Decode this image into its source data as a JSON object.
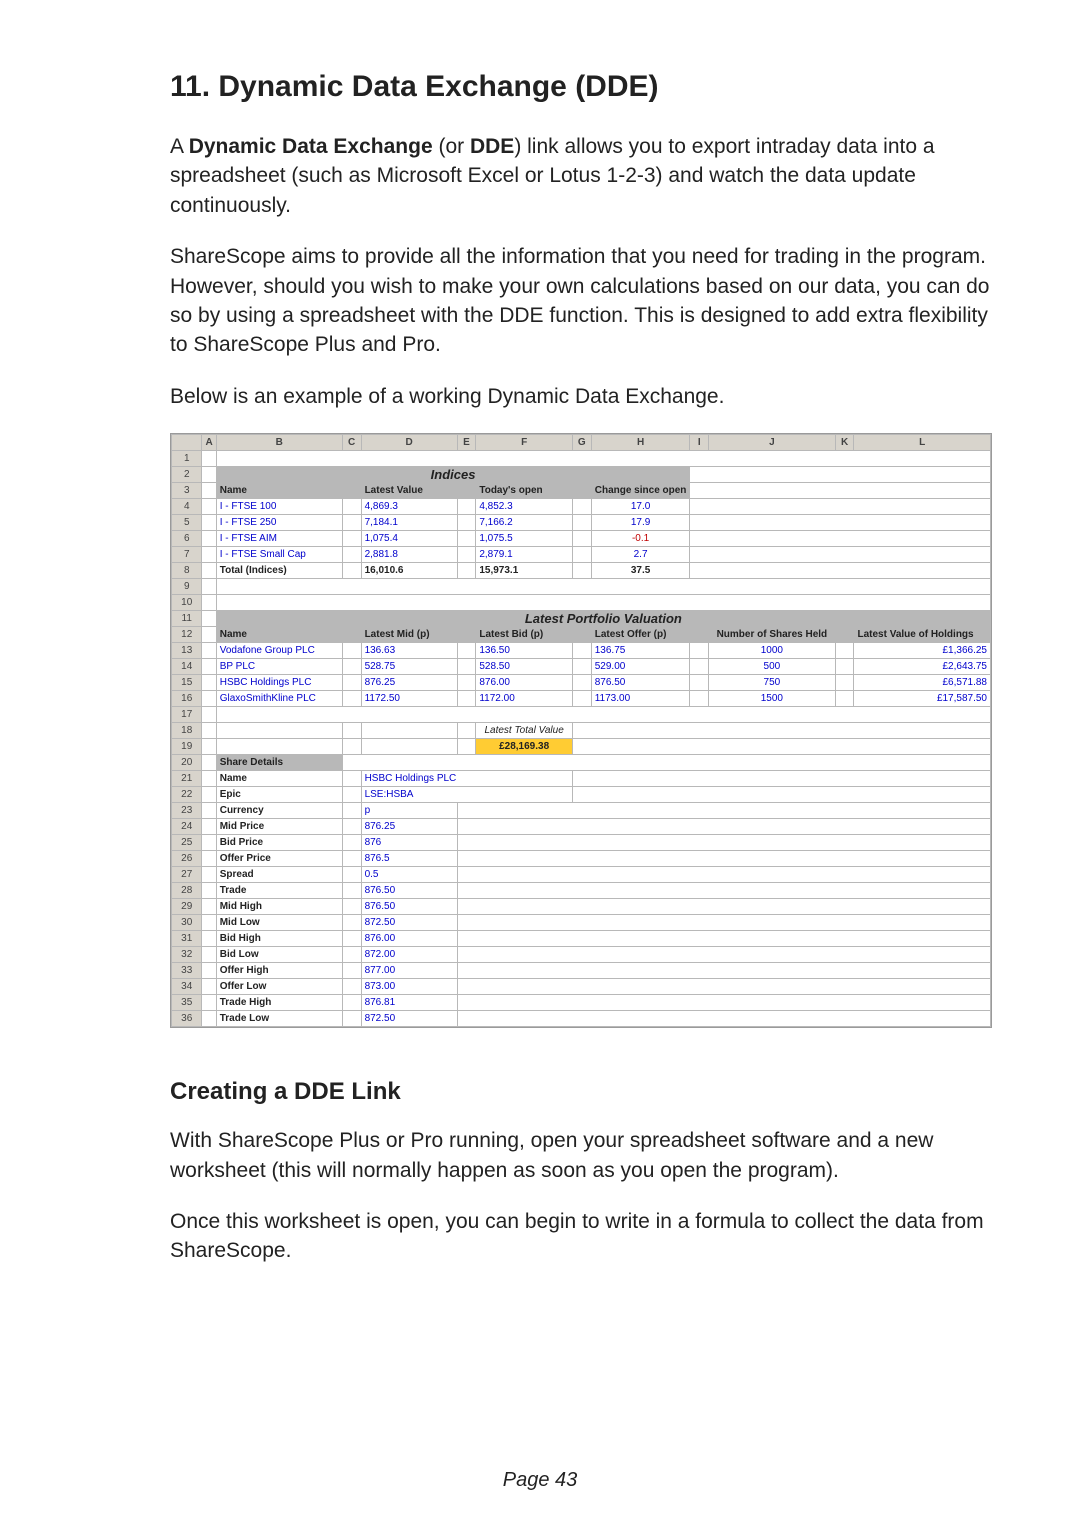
{
  "title": "11. Dynamic Data Exchange (DDE)",
  "intro": {
    "p1_pre": "A ",
    "p1_b1": "Dynamic Data Exchange",
    "p1_mid": " (or ",
    "p1_b2": "DDE",
    "p1_post": ") link allows you to export intraday data into a spreadsheet (such as Microsoft Excel or Lotus 1-2-3) and watch the data update continuously."
  },
  "p2": "ShareScope aims to provide all the information that you need for trading in the program.  However, should you wish to make your own calculations based on our data, you can do so by using a spreadsheet with the DDE function.  This is designed to add extra flexibility to ShareScope Plus and Pro.",
  "p3": "Below is an example of a working Dynamic Data Exchange.",
  "sub_title": "Creating a DDE Link",
  "p4": "With ShareScope Plus or Pro running, open your spreadsheet software and a new worksheet (this will normally happen as soon as you open the program).",
  "p5": "Once this worksheet is open, you can begin to write in a formula to collect the data from ShareScope.",
  "page_number": "Page 43",
  "sheet": {
    "cols": [
      "A",
      "B",
      "C",
      "D",
      "E",
      "F",
      "G",
      "H",
      "I",
      "J",
      "K",
      "L"
    ],
    "sec1_title": "Indices",
    "sec1_headers": [
      "Name",
      "Latest Value",
      "Today's open",
      "Change since open"
    ],
    "sec1_rows": [
      {
        "name": "I - FTSE 100",
        "latest": "4,869.3",
        "open": "4,852.3",
        "change": "17.0"
      },
      {
        "name": "I - FTSE 250",
        "latest": "7,184.1",
        "open": "7,166.2",
        "change": "17.9"
      },
      {
        "name": "I - FTSE AIM",
        "latest": "1,075.4",
        "open": "1,075.5",
        "change": "-0.1",
        "neg": true
      },
      {
        "name": "I - FTSE Small Cap",
        "latest": "2,881.8",
        "open": "2,879.1",
        "change": "2.7"
      }
    ],
    "sec1_total": {
      "name": "Total (Indices)",
      "latest": "16,010.6",
      "open": "15,973.1",
      "change": "37.5"
    },
    "sec2_title": "Latest Portfolio Valuation",
    "sec2_headers": [
      "Name",
      "Latest Mid (p)",
      "Latest Bid (p)",
      "Latest Offer (p)",
      "Number of Shares Held",
      "Latest  Value of Holdings"
    ],
    "sec2_rows": [
      {
        "name": "Vodafone Group PLC",
        "mid": "136.63",
        "bid": "136.50",
        "offer": "136.75",
        "held": "1000",
        "value": "£1,366.25"
      },
      {
        "name": "BP PLC",
        "mid": "528.75",
        "bid": "528.50",
        "offer": "529.00",
        "held": "500",
        "value": "£2,643.75"
      },
      {
        "name": "HSBC Holdings PLC",
        "mid": "876.25",
        "bid": "876.00",
        "offer": "876.50",
        "held": "750",
        "value": "£6,571.88"
      },
      {
        "name": "GlaxoSmithKline PLC",
        "mid": "1172.50",
        "bid": "1172.00",
        "offer": "1173.00",
        "held": "1500",
        "value": "£17,587.50"
      }
    ],
    "latest_total_label": "Latest Total Value",
    "latest_total_value": "£28,169.38",
    "share_details_title": "Share Details",
    "share_details": [
      {
        "label": "Name",
        "value": "HSBC Holdings PLC"
      },
      {
        "label": "Epic",
        "value": "LSE:HSBA"
      },
      {
        "label": "Currency",
        "value": "p"
      },
      {
        "label": "Mid Price",
        "value": "876.25"
      },
      {
        "label": "Bid Price",
        "value": "876"
      },
      {
        "label": "Offer Price",
        "value": "876.5"
      },
      {
        "label": "Spread",
        "value": "0.5"
      },
      {
        "label": "Trade",
        "value": "876.50"
      },
      {
        "label": "Mid High",
        "value": "876.50"
      },
      {
        "label": "Mid Low",
        "value": "872.50"
      },
      {
        "label": "Bid High",
        "value": "876.00"
      },
      {
        "label": "Bid Low",
        "value": "872.00"
      },
      {
        "label": "Offer High",
        "value": "877.00"
      },
      {
        "label": "Offer Low",
        "value": "873.00"
      },
      {
        "label": "Trade High",
        "value": "876.81"
      },
      {
        "label": "Trade Low",
        "value": "872.50"
      }
    ]
  }
}
